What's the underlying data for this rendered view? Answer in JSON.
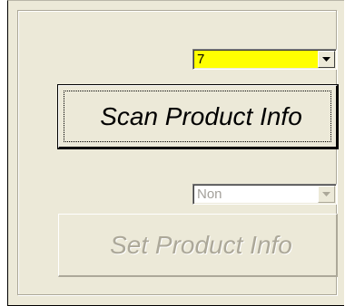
{
  "quantity_select": {
    "value": "7",
    "icon": "chevron-down-icon",
    "field_color": "#ffff00"
  },
  "scan_button": {
    "label": "Scan Product Info"
  },
  "mode_select": {
    "value": "Non",
    "icon": "chevron-down-icon",
    "disabled": true
  },
  "set_button": {
    "label": "Set Product Info",
    "disabled": true
  }
}
